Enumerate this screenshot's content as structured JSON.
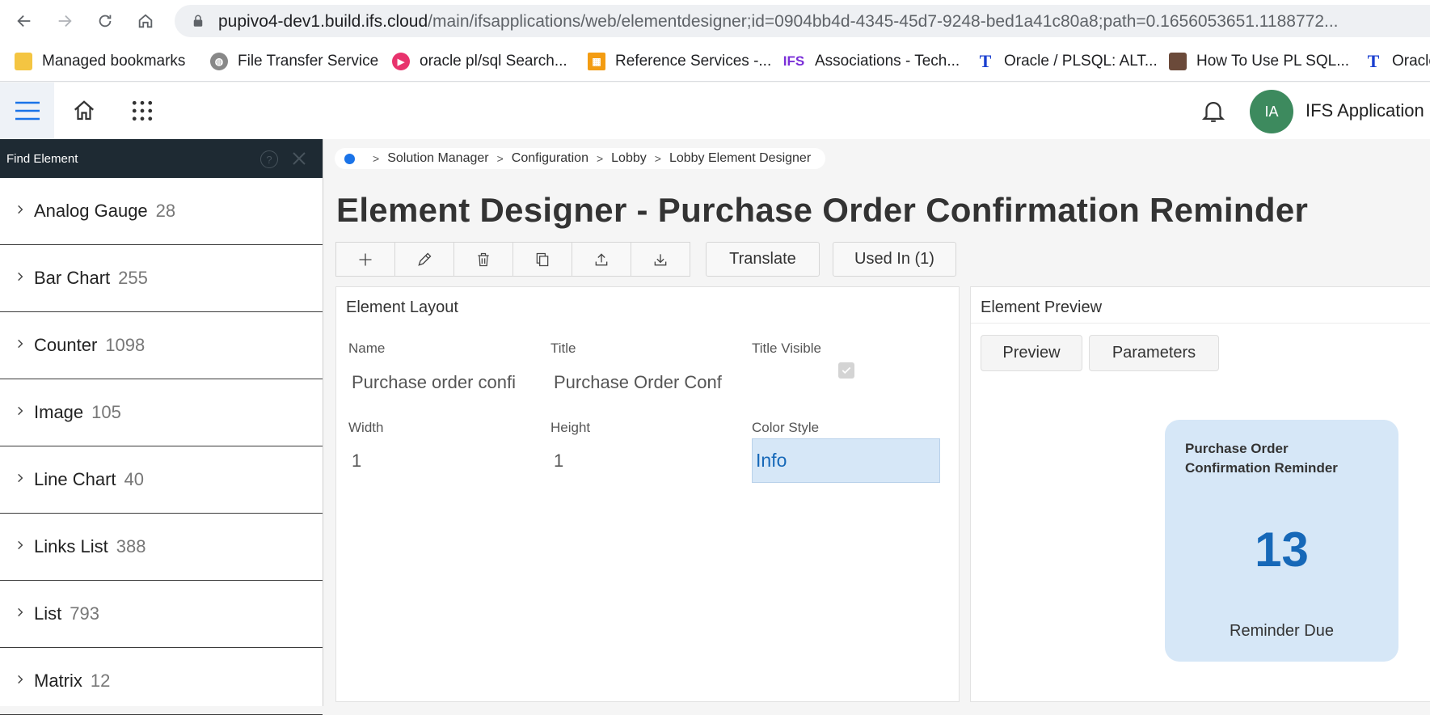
{
  "browser": {
    "url_host": "pupivo4-dev1.build.ifs.cloud",
    "url_path": "/main/ifsapplications/web/elementdesigner;id=0904bb4d-4345-45d7-9248-bed1a41c80a8;path=0.1656053651.1188772...",
    "bookmarks": [
      {
        "label": "Managed bookmarks",
        "icon": "folder-icon"
      },
      {
        "label": "File Transfer Service",
        "icon": "globe-icon"
      },
      {
        "label": "oracle pl/sql Search...",
        "icon": "play-icon"
      },
      {
        "label": "Reference Services -...",
        "icon": "grid-icon"
      },
      {
        "label": "Associations - Tech...",
        "icon": "ifs-icon"
      },
      {
        "label": "Oracle / PLSQL: ALT...",
        "icon": "t-icon"
      },
      {
        "label": "How To Use PL SQL...",
        "icon": "box-icon"
      },
      {
        "label": "Oracle",
        "icon": "t-icon"
      }
    ]
  },
  "header": {
    "avatar_initials": "IA",
    "user_name": "IFS Application"
  },
  "left_panel": {
    "title": "Find Element",
    "help_label": "?",
    "items": [
      {
        "label": "Analog Gauge",
        "count": "28"
      },
      {
        "label": "Bar Chart",
        "count": "255"
      },
      {
        "label": "Counter",
        "count": "1098"
      },
      {
        "label": "Image",
        "count": "105"
      },
      {
        "label": "Line Chart",
        "count": "40"
      },
      {
        "label": "Links List",
        "count": "388"
      },
      {
        "label": "List",
        "count": "793"
      },
      {
        "label": "Matrix",
        "count": "12"
      }
    ]
  },
  "breadcrumb": [
    "Solution Manager",
    "Configuration",
    "Lobby",
    "Lobby Element Designer"
  ],
  "page_title": "Element Designer - Purchase Order Confirmation Reminder",
  "toolbar": {
    "translate": "Translate",
    "used_in": "Used In (1)"
  },
  "layout_card": {
    "title": "Element Layout",
    "name_label": "Name",
    "name_value": "Purchase order confi",
    "title_label": "Title",
    "title_value": "Purchase Order Conf",
    "title_visible_label": "Title Visible",
    "width_label": "Width",
    "width_value": "1",
    "height_label": "Height",
    "height_value": "1",
    "color_style_label": "Color Style",
    "color_style_value": "Info"
  },
  "preview_card": {
    "title": "Element Preview",
    "tab_preview": "Preview",
    "tab_parameters": "Parameters",
    "tile_title": "Purchase Order Confirmation Reminder",
    "tile_value": "13",
    "tile_subtitle": "Reminder Due"
  },
  "colors": {
    "panel_header": "#1e2a33",
    "accent": "#1668b8",
    "tile_bg": "#d6e7f7",
    "avatar": "#3d8a5e"
  }
}
